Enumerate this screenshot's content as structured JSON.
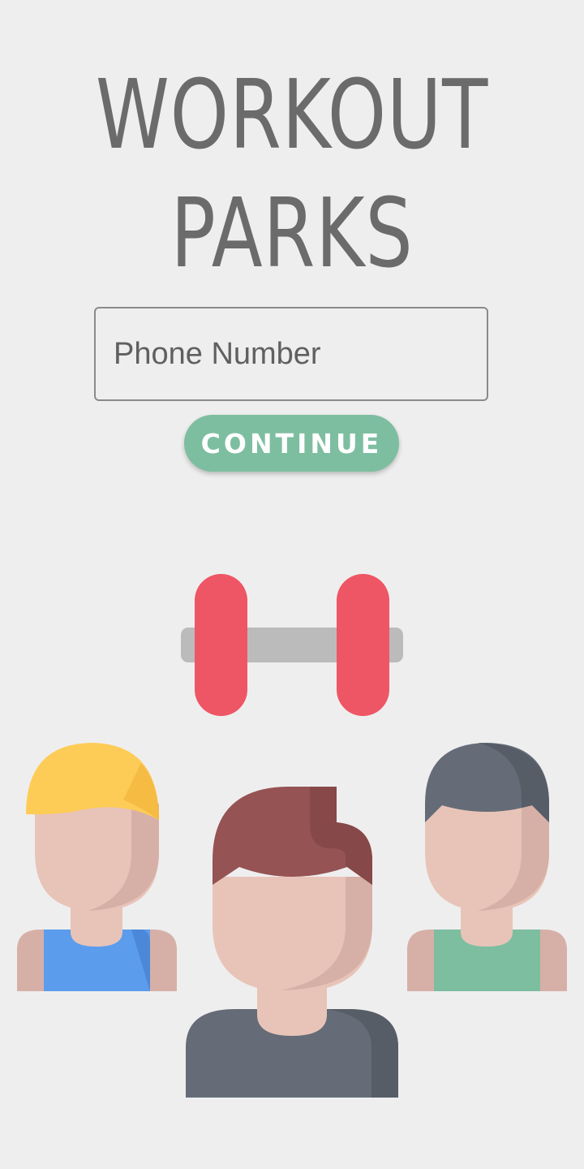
{
  "header": {
    "title_line1": "WORKOUT",
    "title_line2": "PARKS"
  },
  "form": {
    "phone_placeholder": "Phone Number",
    "phone_value": "",
    "continue_label": "CONTINUE"
  },
  "colors": {
    "background": "#efeeef",
    "title": "#6b6b6b",
    "button": "#7dbea0",
    "dumbbell_plate": "#ee5665",
    "dumbbell_bar": "#bcbbbc"
  },
  "illustration": {
    "icons": [
      "dumbbell-icon",
      "person-blonde-icon",
      "person-brown-hair-icon",
      "person-dark-hair-icon"
    ]
  }
}
